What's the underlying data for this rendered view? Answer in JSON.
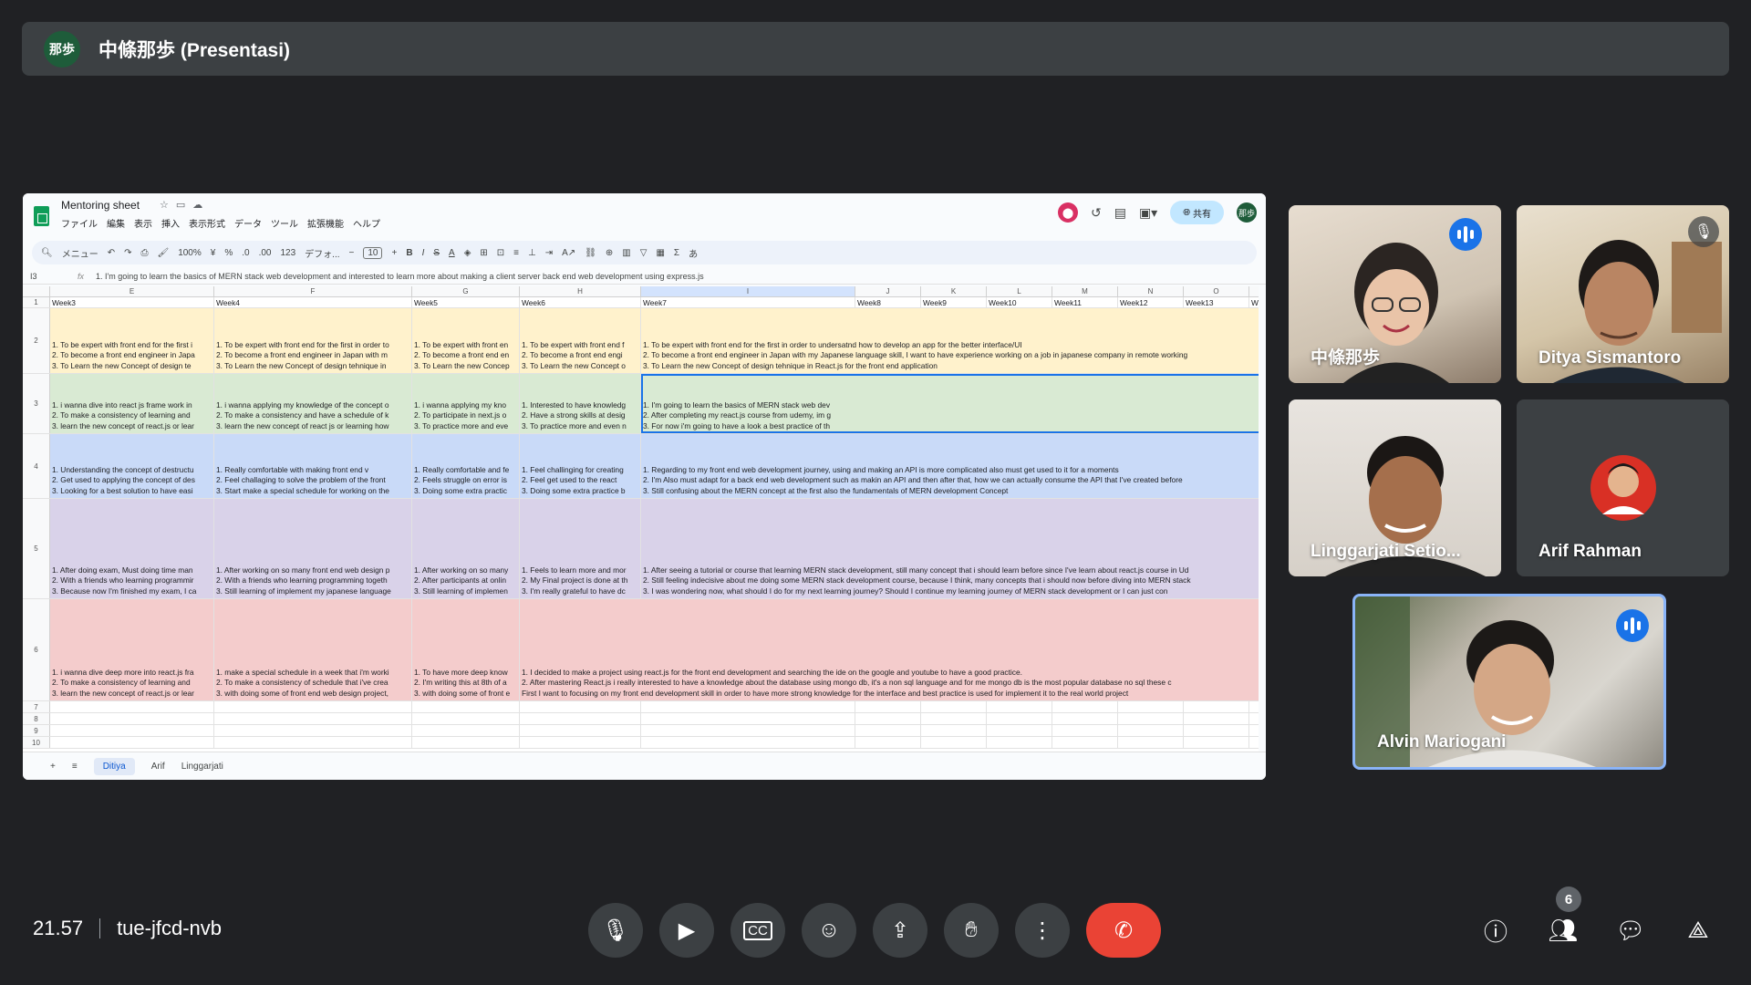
{
  "meeting": {
    "presenter_initials": "那歩",
    "presenter_label": "中條那歩 (Presentasi)",
    "time": "21.57",
    "code": "tue-jfcd-nvb",
    "participant_count": "6"
  },
  "sheet": {
    "title": "Mentoring sheet",
    "menus": [
      "ファイル",
      "編集",
      "表示",
      "挿入",
      "表示形式",
      "データ",
      "ツール",
      "拡張機能",
      "ヘルプ"
    ],
    "share_label": "共有",
    "user_initials": "那歩",
    "toolbar": {
      "search": "メニュー",
      "zoom": "100%",
      "currency": "¥",
      "percent": "%",
      "decimals_down": ".0",
      "decimals_up": ".00",
      "number_format": "123",
      "font": "デフォ...",
      "font_size": "10"
    },
    "name_box": "I3",
    "formula": "1. I'm going to learn the basics of MERN stack web development and interested to learn more about making a client server back end web development using express.js",
    "columns": [
      "E",
      "F",
      "G",
      "H",
      "I",
      "J",
      "K",
      "L",
      "M",
      "N",
      "O"
    ],
    "rows": [
      {
        "num": "1",
        "color": "",
        "cells": [
          "Week3",
          "Week4",
          "Week5",
          "Week6",
          "Week7",
          "Week8",
          "Week9",
          "Week10",
          "Week11",
          "Week12",
          "Week13",
          "W"
        ]
      },
      {
        "num": "2",
        "color": "yellow",
        "cells": [
          [
            "1. To be expert with front end for the first i",
            "",
            "2. To become a front end engineer in Japa",
            "",
            "3. To Learn the new Concept of design te"
          ],
          [
            "1. To be expert with front end for the first in order to",
            "",
            "2. To become a front end engineer in Japan with m",
            "",
            "3. To Learn the new Concept of design tehnique in"
          ],
          [
            "",
            "",
            "1. To be expert with front en",
            "2. To become a front end en",
            "3. To Learn the new Concep"
          ],
          [
            "",
            "",
            "1. To be expert with front end f",
            "2. To become a front end engi",
            "3. To Learn the new Concept o"
          ],
          [
            "",
            "",
            "1. To be expert with front end for the first in order to undersatnd how to develop an app for the better interface/UI",
            "2. To become a front end engineer in Japan with my Japanese language skill, I want to have experience working on a job in japanese company in remote working",
            "3. To Learn the new Concept of design tehnique in React.js for the front end application"
          ]
        ]
      },
      {
        "num": "3",
        "color": "green",
        "cells": [
          [
            "1. i wanna dive into react js frame work in",
            "2. To make a consistency of learning and",
            "3. learn the new concept of react.js or lear"
          ],
          [
            "1. i wanna applying my knowledge of the concept o",
            "2. To make a consistency and have a schedule of k",
            "3. learn the new concept of react js or learning how"
          ],
          [
            "1. i wanna applying my kno",
            "2. To participate in next.js o",
            "3. To practice more and eve"
          ],
          [
            "1. Interested to have knowledg",
            "2. Have a strong skills at desig",
            "3. To practice more and even n"
          ],
          [
            "1. I'm going to learn the basics of MERN stack web dev",
            "2. After completing my react.js course from udemy, im g",
            "3. For now i'm going to have a look a best practice of th"
          ]
        ]
      },
      {
        "num": "4",
        "color": "blue",
        "cells": [
          [
            "1. Understanding the concept of destructu",
            "2. Get used to applying the concept of des",
            "3. Looking for a best solution to have easi"
          ],
          [
            "1. Really comfortable with making front end v",
            "2. Feel challaging to solve the problem of the front",
            "3. Start make a special schedule for working on the"
          ],
          [
            "1. Really comfortable and fe",
            "2. Feels struggle on error is",
            "3. Doing some extra practic"
          ],
          [
            "1. Feel challinging for creating",
            "2. Feel get used to the react",
            "3. Doing some extra practice b"
          ],
          [
            "1. Regarding to my front end web development journey, using and making an API is more complicated also must get used to it for a moments",
            "2. I'm Also must adapt for a back end web development such as makin an API and then after that, how we can actually consume the API that I've created before",
            "3. Still confusing about the MERN concept at the first also the fundamentals of MERN development Concept"
          ]
        ]
      },
      {
        "num": "5",
        "color": "purple",
        "cells": [
          [
            "1. After doing exam, Must doing time man",
            "2. With a friends who learning programmir",
            "3. Because now I'm finished my exam, I ca"
          ],
          [
            "1. After working on so many front end web design p",
            "2. With a friends who learning programming togeth",
            "3. Still learning of implement my japanese language"
          ],
          [
            "1. After working on so many",
            "2. After participants at onlin",
            "3. Still learning of implemen"
          ],
          [
            "1. Feels to learn more and mor",
            "2. My Final project is done at th",
            "3. I'm really grateful to have dc"
          ],
          [
            "1. After seeing a tutorial or course that learning MERN stack development, still many concept that i should learn before since I've learn about react.js course in Ud",
            "2. Still feeling indecisive about me doing some MERN stack development course, because I think, many concepts that i should now before diving into MERN stack",
            "3. I was wondering now, what should I do for my next learning journey? Should I continue my learning journey of MERN stack development or I can just con"
          ]
        ]
      },
      {
        "num": "6",
        "color": "red",
        "cells": [
          [
            "1. i wanna dive deep more into react.js fra",
            "2. To make a consistency of learning and",
            "3. learn the new concept of react.js or lear"
          ],
          [
            "1. make a special schedule in a week that i'm worki",
            "2. To make a consistency of schedule that i've crea",
            "3. with doing some of front end web design project,"
          ],
          [
            "1. To have more deep know",
            "2. I'm writing this at 8th of a",
            "3. with doing some of front e"
          ],
          [
            "1. I decided to make a project using react.js for the front end development and searching the ide on the google and youtube to have a good practice.",
            "2. After mastering React.js i really interested to have a knowledge about the database using mongo db, it's a non sql language and for me mongo db is the most popular database no sql these c",
            "First I want to focusing on my front end development skill in order to have more strong knowledge for the interface and best practice is used for implement it to the real world project"
          ]
        ]
      }
    ],
    "empty_rows": [
      "7",
      "8",
      "9",
      "10"
    ],
    "tabs": {
      "add": "+",
      "all": "≡",
      "items": [
        "Ditiya",
        "Arif",
        "Linggarjati"
      ]
    }
  },
  "participants": [
    {
      "name": "中條那歩",
      "speaking": true
    },
    {
      "name": "Ditya Sismantoro",
      "muted": true
    },
    {
      "name": "Linggarjati Setio..."
    },
    {
      "name": "Arif Rahman"
    },
    {
      "name": "Alvin Mariogani",
      "speaking": true
    }
  ],
  "colors": {
    "accent": "#1a73e8",
    "end_call": "#ea4335",
    "sheet_green": "#0f9d58"
  }
}
